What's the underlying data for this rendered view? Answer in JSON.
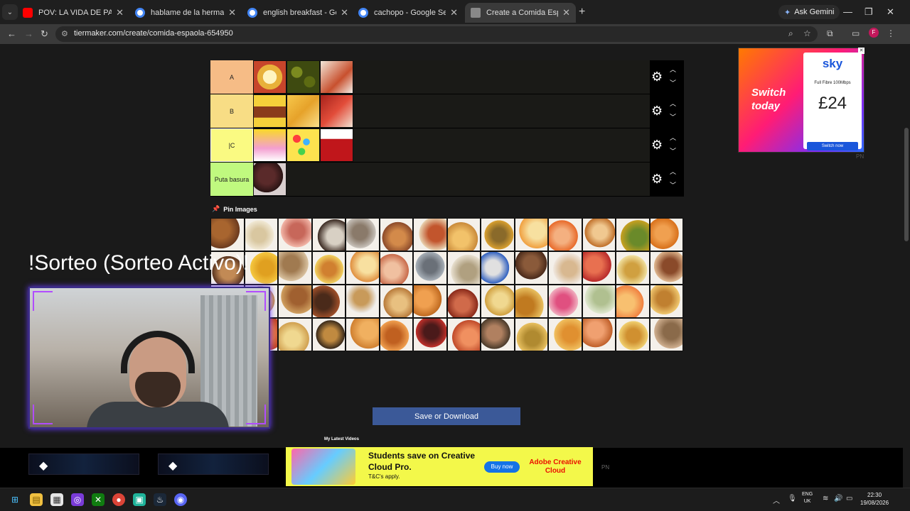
{
  "browser": {
    "tabs": [
      {
        "title": "POV: LA VIDA DE PABLO CON E",
        "favicon_color": "#ff0000",
        "active": false
      },
      {
        "title": "hablame de la hermandad mus",
        "favicon_color": "#4285f4",
        "active": false
      },
      {
        "title": "english breakfast - Google Sea",
        "favicon_color": "#4285f4",
        "active": false
      },
      {
        "title": "cachopo - Google Search",
        "favicon_color": "#4285f4",
        "active": false
      },
      {
        "title": "Create a Comida Española Tier",
        "favicon_color": "#888888",
        "active": true
      }
    ],
    "new_tab": "+",
    "gemini_label": "Ask Gemini",
    "url": "tiermaker.com/create/comida-espaola-654950",
    "profile_initial": "F"
  },
  "tiers": [
    {
      "label": "",
      "color": "#f4727a",
      "item_count": 3
    },
    {
      "label": "A",
      "color": "#f6bc86",
      "item_count": 3
    },
    {
      "label": "B",
      "color": "#f8dd85",
      "item_count": 3
    },
    {
      "label": "|C",
      "color": "#fafa82",
      "item_count": 3
    },
    {
      "label": "Puta basura",
      "color": "#c0f97f",
      "item_count": 1
    }
  ],
  "pin_images_label": "Pin Images",
  "save_button": "Save or Download",
  "latest_videos": "My Latest Videos",
  "overlay_title": "!Sorteo (Sorteo Activo)!",
  "ads": {
    "sky": {
      "logo": "sky",
      "headline": "Switch today",
      "fibre": "Full Fibre 100Mbps",
      "price": "£24",
      "cta": "Switch now",
      "tag": "PN"
    },
    "adobe": {
      "headline": "Students save on Creative Cloud Pro.",
      "tc": "T&C's apply.",
      "cta": "Buy now",
      "brand": "Adobe Creative Cloud",
      "tag": "PN"
    }
  },
  "tray": {
    "lang": "ENG",
    "region": "UK",
    "time": "22:30",
    "date": "19/08/2026"
  },
  "icons": {
    "back": "back-arrow-icon",
    "reload": "reload-icon",
    "zoom": "zoom-icon",
    "star": "bookmark-star-icon",
    "extensions": "extensions-icon",
    "settings": "gear-icon"
  }
}
